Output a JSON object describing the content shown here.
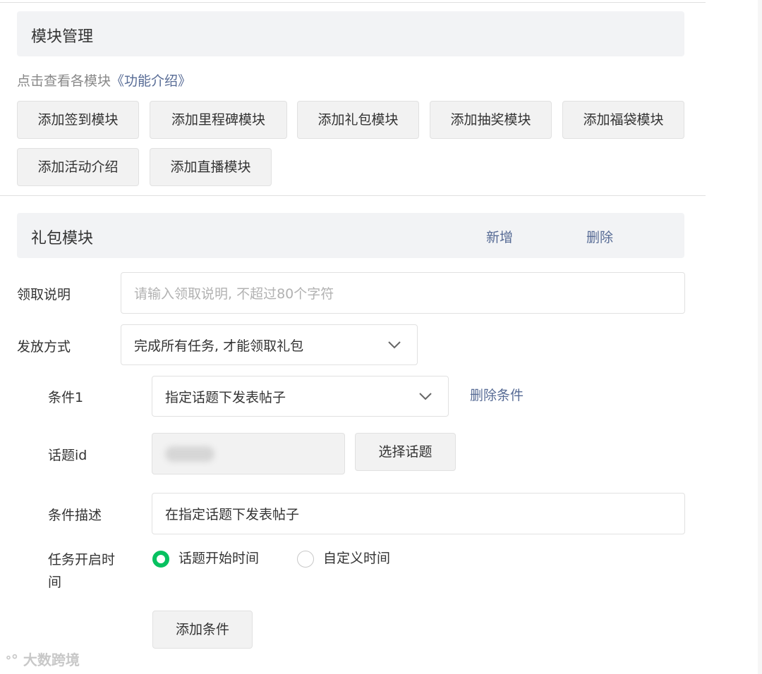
{
  "module_management": {
    "title": "模块管理",
    "hint_text": "点击查看各模块",
    "hint_link": "《功能介绍》",
    "add_buttons": [
      "添加签到模块",
      "添加里程碑模块",
      "添加礼包模块",
      "添加抽奖模块",
      "添加福袋模块",
      "添加活动介绍",
      "添加直播模块"
    ]
  },
  "gift_module": {
    "title": "礼包模块",
    "add_label": "新增",
    "delete_label": "删除",
    "claim_desc_label": "领取说明",
    "claim_desc_placeholder": "请输入领取说明, 不超过80个字符",
    "distribution_label": "发放方式",
    "distribution_value": "完成所有任务, 才能领取礼包",
    "condition": {
      "label": "条件1",
      "type_value": "指定话题下发表帖子",
      "delete_label": "删除条件",
      "topic_id_label": "话题id",
      "select_topic_label": "选择话题",
      "desc_label": "条件描述",
      "desc_value": "在指定话题下发表帖子",
      "start_time_label": "任务开启时间",
      "start_time_options": [
        {
          "label": "话题开始时间",
          "checked": true
        },
        {
          "label": "自定义时间",
          "checked": false
        }
      ]
    },
    "add_condition_label": "添加条件"
  },
  "watermark": "大数跨境",
  "colors": {
    "accent_link": "#576b95",
    "radio_checked": "#07c160",
    "section_bg": "#f2f3f5"
  }
}
